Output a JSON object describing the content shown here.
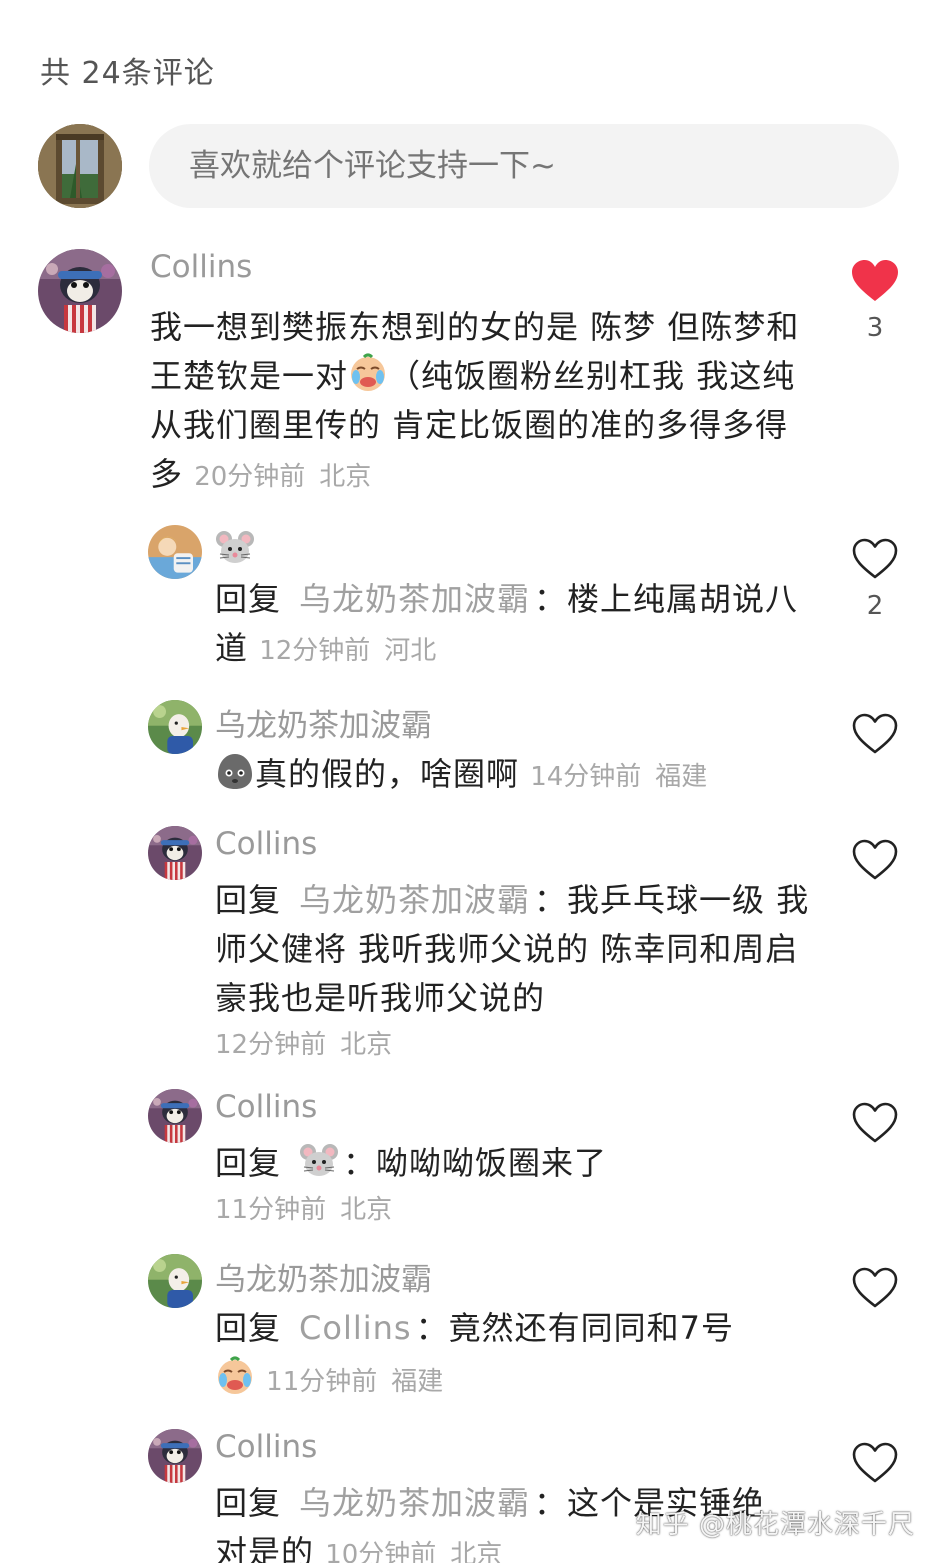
{
  "header": {
    "comment_count_label": "共 24条评论"
  },
  "composer": {
    "placeholder": "喜欢就给个评论支持一下~"
  },
  "comments": [
    {
      "username": "Collins",
      "text_before_emoji": "我一想到樊振东想到的女的是 陈梦 但陈梦和王楚钦是一对",
      "text_after_emoji": "（纯饭圈粉丝别杠我 我这纯从我们圈里传的 肯定比饭圈的准的多得多得多",
      "time": "20分钟前",
      "location": "北京",
      "likes": "3",
      "liked": true,
      "emoji": "crying-face"
    },
    {
      "username_emoji": "mouse-face",
      "reply_word": "回复",
      "reply_target": "乌龙奶茶加波霸",
      "colon": "：",
      "text": "楼上纯属胡说八道",
      "time": "12分钟前",
      "location": "河北",
      "likes": "2",
      "liked": false
    },
    {
      "username": "乌龙奶茶加波霸",
      "text": "真的假的，啥圈啊",
      "time": "14分钟前",
      "location": "福建",
      "likes": "",
      "liked": false,
      "emoji": "gray-blob-face"
    },
    {
      "username": "Collins",
      "reply_word": "回复",
      "reply_target": "乌龙奶茶加波霸",
      "colon": "：",
      "text": "我乒乓球一级 我师父健将 我听我师父说的 陈幸同和周启豪我也是听我师父说的",
      "time": "12分钟前",
      "location": "北京",
      "likes": "",
      "liked": false
    },
    {
      "username": "Collins",
      "reply_word": "回复",
      "reply_target_emoji": "mouse-face",
      "colon": "：",
      "text": "呦呦呦饭圈来了",
      "time": "11分钟前",
      "location": "北京",
      "likes": "",
      "liked": false
    },
    {
      "username": "乌龙奶茶加波霸",
      "reply_word": "回复",
      "reply_target": "Collins",
      "colon": "：",
      "text": "竟然还有同同和7号",
      "time": "11分钟前",
      "location": "福建",
      "likes": "",
      "liked": false,
      "emoji": "crying-face"
    },
    {
      "username": "Collins",
      "reply_word": "回复",
      "reply_target": "乌龙奶茶加波霸",
      "colon": "：",
      "text": "这个是实锤绝对是的",
      "time": "10分钟前",
      "location": "北京",
      "likes": "",
      "liked": false
    }
  ],
  "watermark": "知乎 @桃花潭水深千尺",
  "colors": {
    "like_red": "#f0334a",
    "meta_gray": "#a8a8a8",
    "name_gray": "#9a9a9a",
    "input_bg": "#f3f3f3"
  }
}
